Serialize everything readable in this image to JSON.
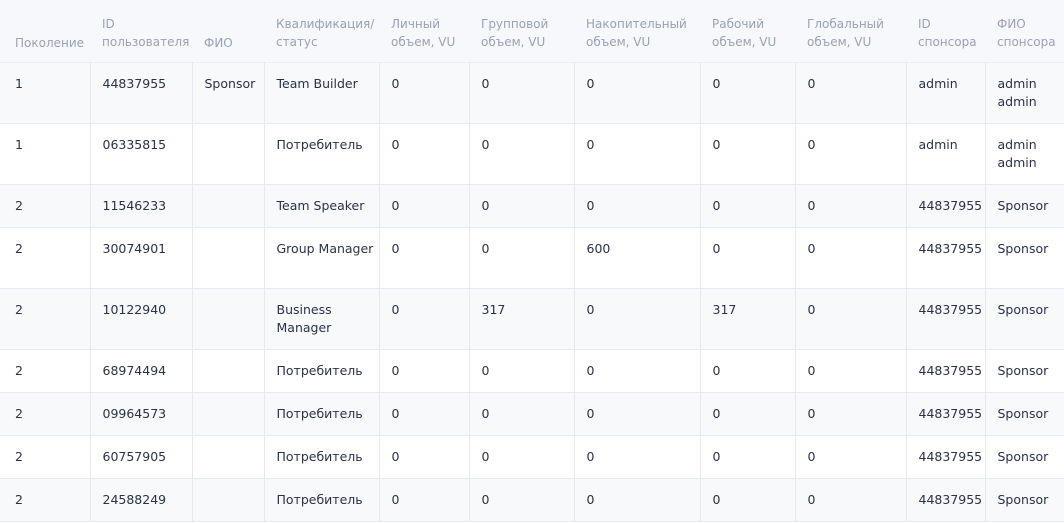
{
  "table": {
    "headers": [
      {
        "l1": "Поколение",
        "l2": ""
      },
      {
        "l1": "ID",
        "l2": "пользователя"
      },
      {
        "l1": "ФИО",
        "l2": ""
      },
      {
        "l1": "Квалификация/",
        "l2": "статус"
      },
      {
        "l1": "Личный",
        "l2": "объем, VU"
      },
      {
        "l1": "Групповой",
        "l2": "объем, VU"
      },
      {
        "l1": "Накопительный",
        "l2": "объем, VU"
      },
      {
        "l1": "Рабочий",
        "l2": "объем, VU"
      },
      {
        "l1": "Глобальный",
        "l2": "объем, VU"
      },
      {
        "l1": "ID",
        "l2": "спонсора"
      },
      {
        "l1": "ФИО",
        "l2": "спонсора"
      }
    ],
    "rows": [
      {
        "generation": "1",
        "user_id": "44837955",
        "name": "Sponsor",
        "qualification": "Team Builder",
        "personal": "0",
        "group": "0",
        "cumulative": "0",
        "working": "0",
        "global": "0",
        "sponsor_id": "admin",
        "sponsor_name": "admin admin"
      },
      {
        "generation": "1",
        "user_id": "06335815",
        "name": "",
        "qualification": "Потребитель",
        "personal": "0",
        "group": "0",
        "cumulative": "0",
        "working": "0",
        "global": "0",
        "sponsor_id": "admin",
        "sponsor_name": "admin admin"
      },
      {
        "generation": "2",
        "user_id": "11546233",
        "name": "",
        "qualification": "Team Speaker",
        "personal": "0",
        "group": "0",
        "cumulative": "0",
        "working": "0",
        "global": "0",
        "sponsor_id": "44837955",
        "sponsor_name": "Sponsor"
      },
      {
        "generation": "2",
        "user_id": "30074901",
        "name": "",
        "qualification": "Group Manager",
        "personal": "0",
        "group": "0",
        "cumulative": "600",
        "working": "0",
        "global": "0",
        "sponsor_id": "44837955",
        "sponsor_name": "Sponsor"
      },
      {
        "generation": "2",
        "user_id": "10122940",
        "name": "",
        "qualification": "Business Manager",
        "personal": "0",
        "group": "317",
        "cumulative": "0",
        "working": "317",
        "global": "0",
        "sponsor_id": "44837955",
        "sponsor_name": "Sponsor"
      },
      {
        "generation": "2",
        "user_id": "68974494",
        "name": "",
        "qualification": "Потребитель",
        "personal": "0",
        "group": "0",
        "cumulative": "0",
        "working": "0",
        "global": "0",
        "sponsor_id": "44837955",
        "sponsor_name": "Sponsor"
      },
      {
        "generation": "2",
        "user_id": "09964573",
        "name": "",
        "qualification": "Потребитель",
        "personal": "0",
        "group": "0",
        "cumulative": "0",
        "working": "0",
        "global": "0",
        "sponsor_id": "44837955",
        "sponsor_name": "Sponsor"
      },
      {
        "generation": "2",
        "user_id": "60757905",
        "name": "",
        "qualification": "Потребитель",
        "personal": "0",
        "group": "0",
        "cumulative": "0",
        "working": "0",
        "global": "0",
        "sponsor_id": "44837955",
        "sponsor_name": "Sponsor"
      },
      {
        "generation": "2",
        "user_id": "24588249",
        "name": "",
        "qualification": "Потребитель",
        "personal": "0",
        "group": "0",
        "cumulative": "0",
        "working": "0",
        "global": "0",
        "sponsor_id": "44837955",
        "sponsor_name": "Sponsor"
      }
    ]
  }
}
